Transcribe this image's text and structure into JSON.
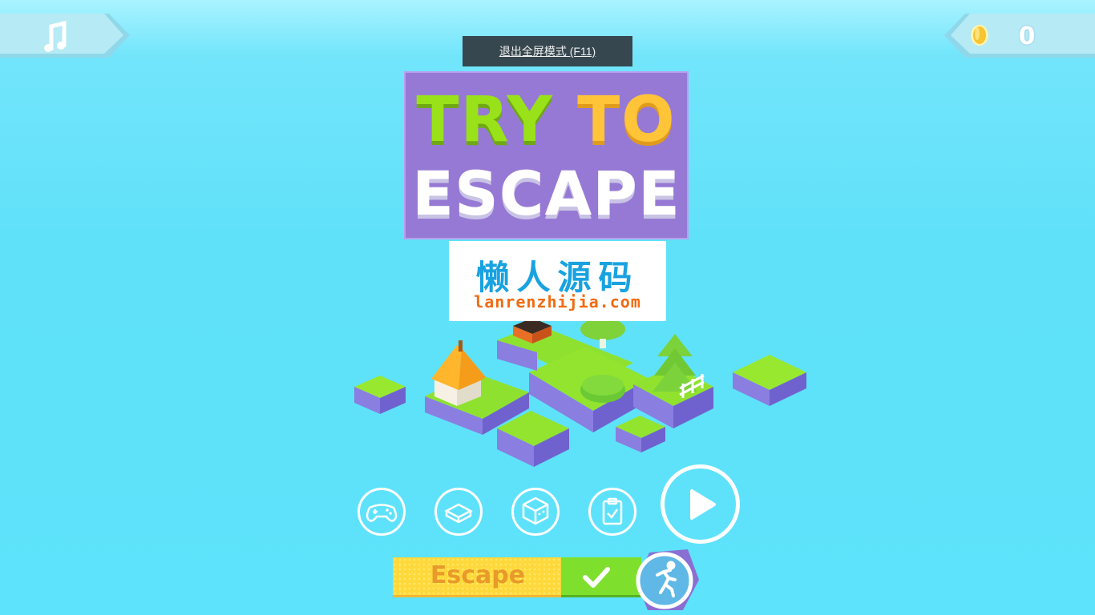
{
  "top_left": {
    "icon": "music-note-icon"
  },
  "top_right": {
    "icon": "coin-icon",
    "coin_count": "0"
  },
  "fullscreen_notice": {
    "text": "退出全屏模式 (F11)"
  },
  "title": {
    "line1_part1": "TRY",
    "line1_part2": "TO",
    "line2": "ESCAPE"
  },
  "watermark": {
    "chinese": "懒人源码",
    "url": "lanrenzhijia.com"
  },
  "menu_buttons": [
    {
      "icon": "gamepad-icon"
    },
    {
      "icon": "block-icon"
    },
    {
      "icon": "cube-face-icon"
    },
    {
      "icon": "clipboard-check-icon"
    },
    {
      "icon": "play-icon"
    }
  ],
  "mode_selector": {
    "label": "Escape",
    "confirm_icon": "check-icon",
    "mode_icon": "running-man-icon"
  },
  "colors": {
    "sky": "#5fe1fa",
    "title_bg": "#9679d4",
    "grass": "#8ee22f",
    "accent_yellow": "#ffd93b"
  }
}
